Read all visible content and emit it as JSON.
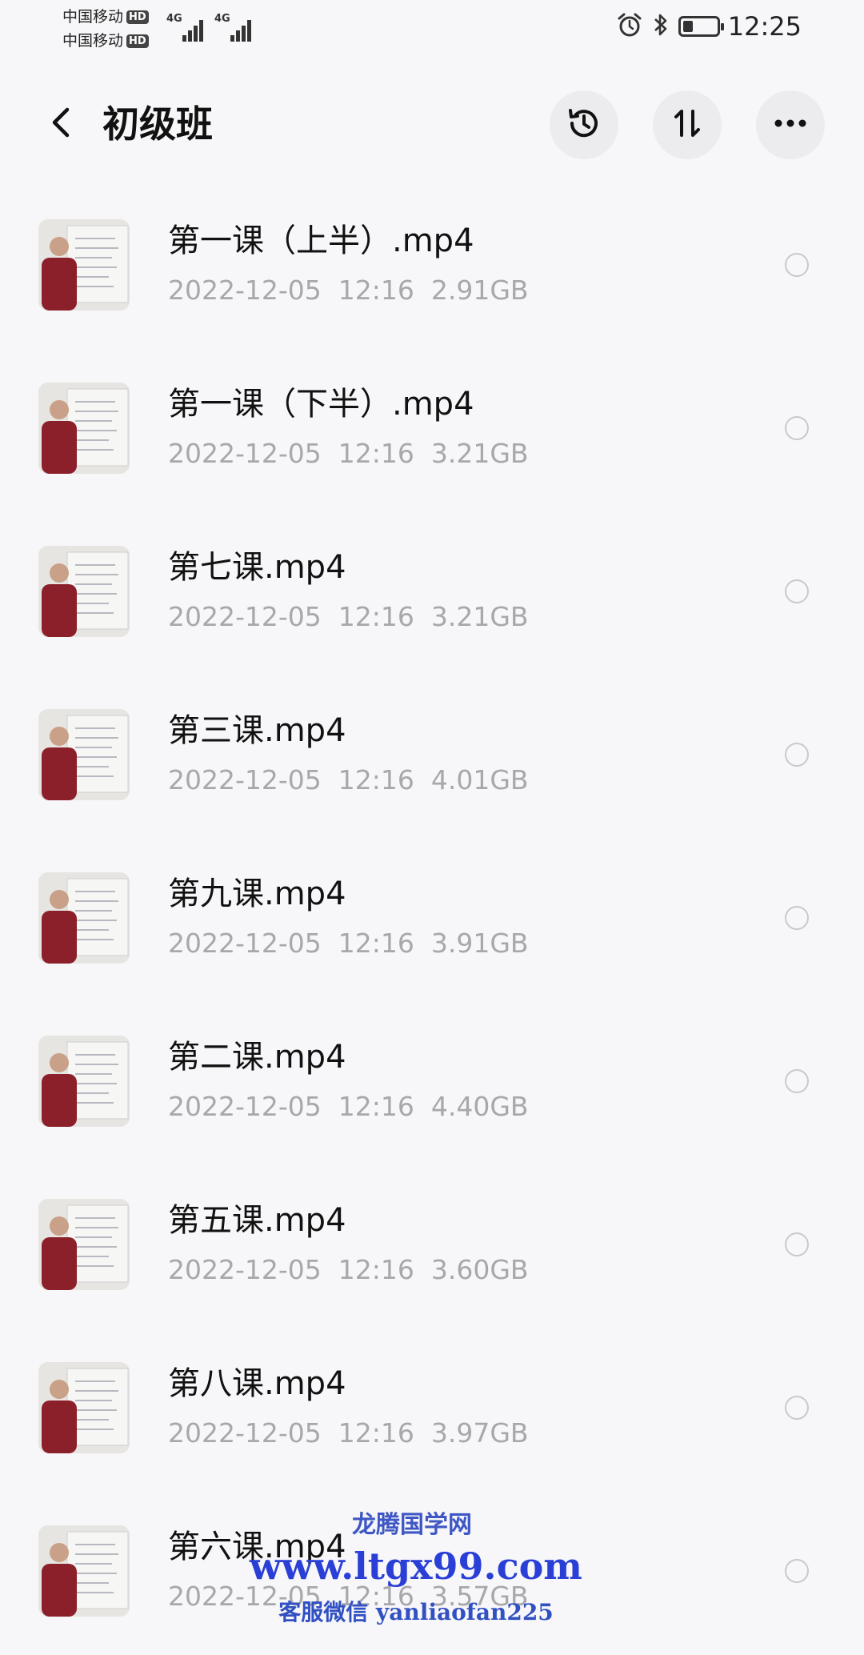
{
  "status_bar": {
    "carrier1": "中国移动",
    "carrier2": "中国移动",
    "hd": "HD",
    "network": "4G",
    "time": "12:25",
    "battery_level": 0.3,
    "icons": [
      "alarm-icon",
      "bluetooth-icon",
      "battery-icon"
    ]
  },
  "header": {
    "title": "初级班",
    "buttons": [
      "back-icon",
      "history-icon",
      "sort-icon",
      "more-icon"
    ]
  },
  "files": [
    {
      "name": "第一课（上半）.mp4",
      "date": "2022-12-05",
      "time": "12:16",
      "size": "2.91GB"
    },
    {
      "name": "第一课（下半）.mp4",
      "date": "2022-12-05",
      "time": "12:16",
      "size": "3.21GB"
    },
    {
      "name": "第七课.mp4",
      "date": "2022-12-05",
      "time": "12:16",
      "size": "3.21GB"
    },
    {
      "name": "第三课.mp4",
      "date": "2022-12-05",
      "time": "12:16",
      "size": "4.01GB"
    },
    {
      "name": "第九课.mp4",
      "date": "2022-12-05",
      "time": "12:16",
      "size": "3.91GB"
    },
    {
      "name": "第二课.mp4",
      "date": "2022-12-05",
      "time": "12:16",
      "size": "4.40GB"
    },
    {
      "name": "第五课.mp4",
      "date": "2022-12-05",
      "time": "12:16",
      "size": "3.60GB"
    },
    {
      "name": "第八课.mp4",
      "date": "2022-12-05",
      "time": "12:16",
      "size": "3.97GB"
    },
    {
      "name": "第六课.mp4",
      "date": "2022-12-05",
      "time": "12:16",
      "size": "3.57GB"
    }
  ],
  "watermark": {
    "line1": "龙腾国学网",
    "line2": "www.ltgx99.com",
    "line3": "客服微信 yanliaofan225"
  },
  "colors": {
    "background": "#f7f7f9",
    "meta_text": "#a8a8ac",
    "watermark": "#2a3fd6"
  }
}
